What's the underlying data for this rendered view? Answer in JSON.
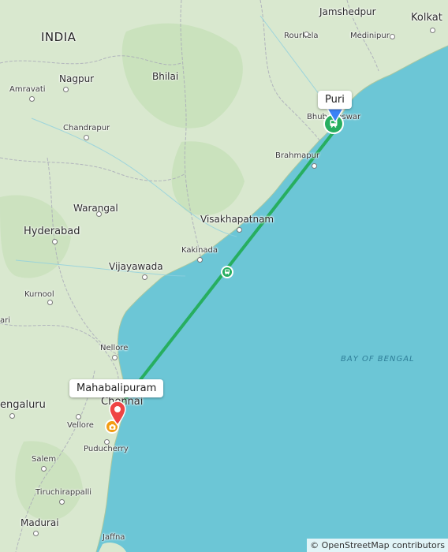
{
  "map": {
    "country": "INDIA",
    "sea": "BAY OF BENGAL",
    "cities": {
      "jamshedpur": "Jamshedpur",
      "kolkata": "Kolkat",
      "rourkela": "Rourkela",
      "medinipur": "Medinipur",
      "nagpur": "Nagpur",
      "bhilai": "Bhilai",
      "amravati": "Amravati",
      "chandrapur": "Chandrapur",
      "bhubaneswar": "Bhubaneswar",
      "brahmapur": "Brahmapur",
      "warangal": "Warangal",
      "visakhapatnam": "Visakhapatnam",
      "hyderabad": "Hyderabad",
      "kakinada": "Kakinada",
      "vijayawada": "Vijayawada",
      "kurnool": "Kurnool",
      "bellary": "ari",
      "nellore": "Nellore",
      "bengaluru": "engaluru",
      "chennai": "Chennai",
      "vellore": "Vellore",
      "puducherry": "Puducherry",
      "salem": "Salem",
      "tiruchirappalli": "Tiruchirappalli",
      "madurai": "Madurai",
      "jaffna": "Jaffna"
    }
  },
  "route": {
    "mode": "train",
    "color": "#27ae60",
    "origin": {
      "name": "Puri",
      "marker_color": "#3b82f6"
    },
    "destination": {
      "name": "Mahabalipuram",
      "marker_color": "#ef4444"
    },
    "midpoint_icon": "train-icon"
  },
  "attribution": "© OpenStreetMap contributors"
}
